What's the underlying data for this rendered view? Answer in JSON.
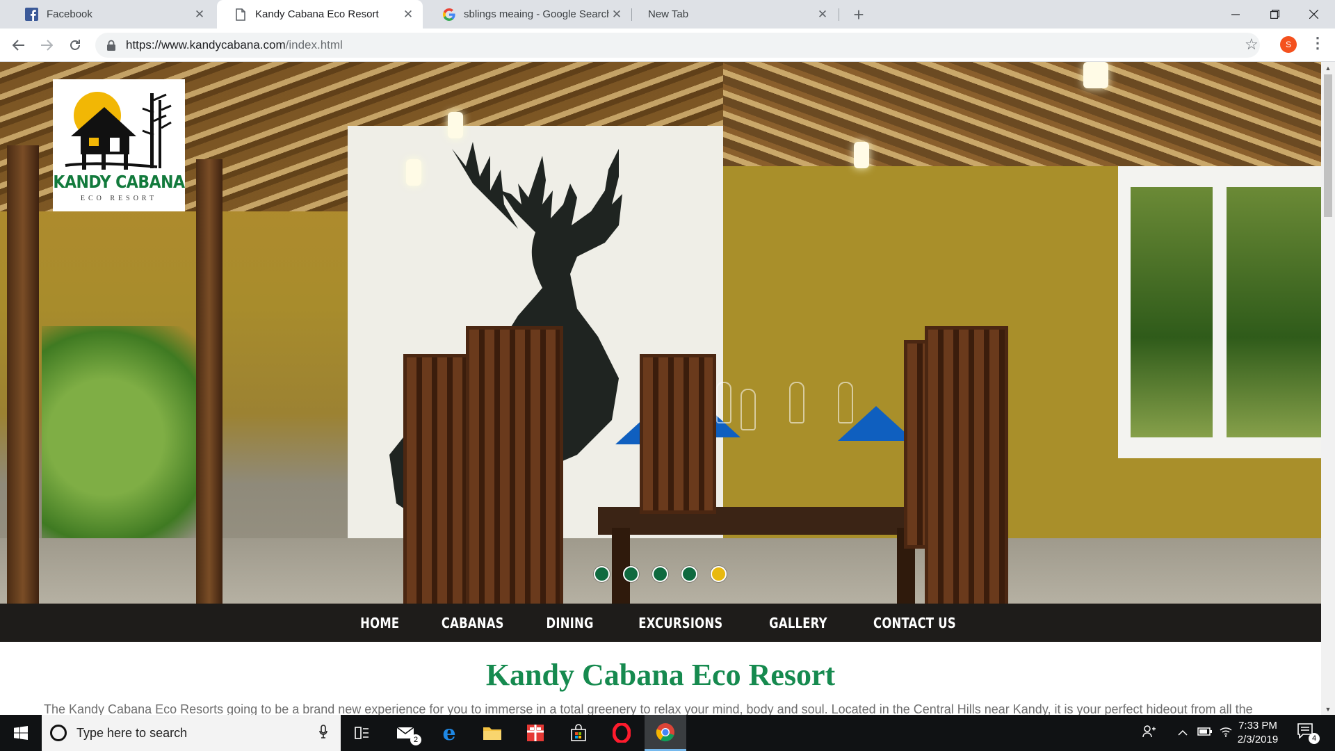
{
  "browser": {
    "tabs": [
      {
        "title": "Facebook",
        "favicon": "facebook-icon",
        "active": false
      },
      {
        "title": "Kandy Cabana Eco Resort",
        "favicon": "page-icon",
        "active": true
      },
      {
        "title": "sblings meaing - Google Search",
        "favicon": "google-icon",
        "active": false
      },
      {
        "title": "New Tab",
        "favicon": "",
        "active": false
      }
    ],
    "close_glyph": "✕",
    "url_host": "https://www.kandycabana.com",
    "url_path": "/index.html",
    "profile_initial": "S",
    "colors": {
      "tabstrip": "#dee1e6",
      "profile": "#f4511e"
    }
  },
  "site": {
    "logo": {
      "title": "KANDY CABANA",
      "subtitle": "ECO RESORT"
    },
    "carousel": {
      "slide_count": 5,
      "active_index": 4,
      "dot_color": "#0f6a3f",
      "active_dot_color": "#e8b90f"
    },
    "nav": [
      "HOME",
      "CABANAS",
      "DINING",
      "EXCURSIONS",
      "GALLERY",
      "CONTACT US"
    ],
    "heading": "Kandy Cabana Eco Resort",
    "intro": "The Kandy Cabana Eco Resorts going to be a brand new experience for you to immerse in a total greenery to relax your mind, body and soul. Located in the Central Hills near Kandy, it is your perfect hideout from all the",
    "colors": {
      "heading": "#168a4f",
      "navbar": "#1e1c1a"
    }
  },
  "taskbar": {
    "search_placeholder": "Type here to search",
    "mail_badge": "2",
    "time": "7:33 PM",
    "date": "2/3/2019",
    "notification_count": "4"
  }
}
